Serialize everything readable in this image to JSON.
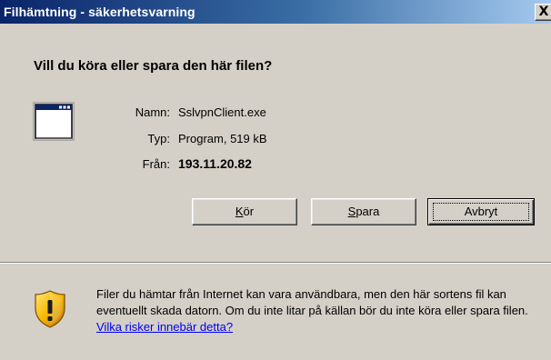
{
  "window": {
    "title": "Filhämtning - säkerhetsvarning",
    "close_label": "X"
  },
  "question": "Vill du köra eller spara den här filen?",
  "file": {
    "icon": "application-window-icon",
    "name_label": "Namn:",
    "name_value": "SslvpnClient.exe",
    "type_label": "Typ:",
    "type_value": "Program, 519 kB",
    "from_label": "Från:",
    "from_value": "193.11.20.82"
  },
  "buttons": {
    "run": {
      "mnemonic": "K",
      "rest": "ör"
    },
    "save": {
      "mnemonic": "S",
      "rest": "para"
    },
    "cancel": {
      "label": "Avbryt"
    }
  },
  "warning": {
    "icon": "security-shield-icon",
    "text": "Filer du hämtar från Internet kan vara användbara, men den här sortens fil kan eventuellt skada datorn. Om du inte litar på källan bör du inte köra eller spara filen. ",
    "link": "Vilka risker innebär detta?"
  },
  "colors": {
    "titlebar_start": "#0a246a",
    "titlebar_end": "#a6caf0",
    "dialog_background": "#d4d0c8",
    "link": "#0000ee"
  }
}
